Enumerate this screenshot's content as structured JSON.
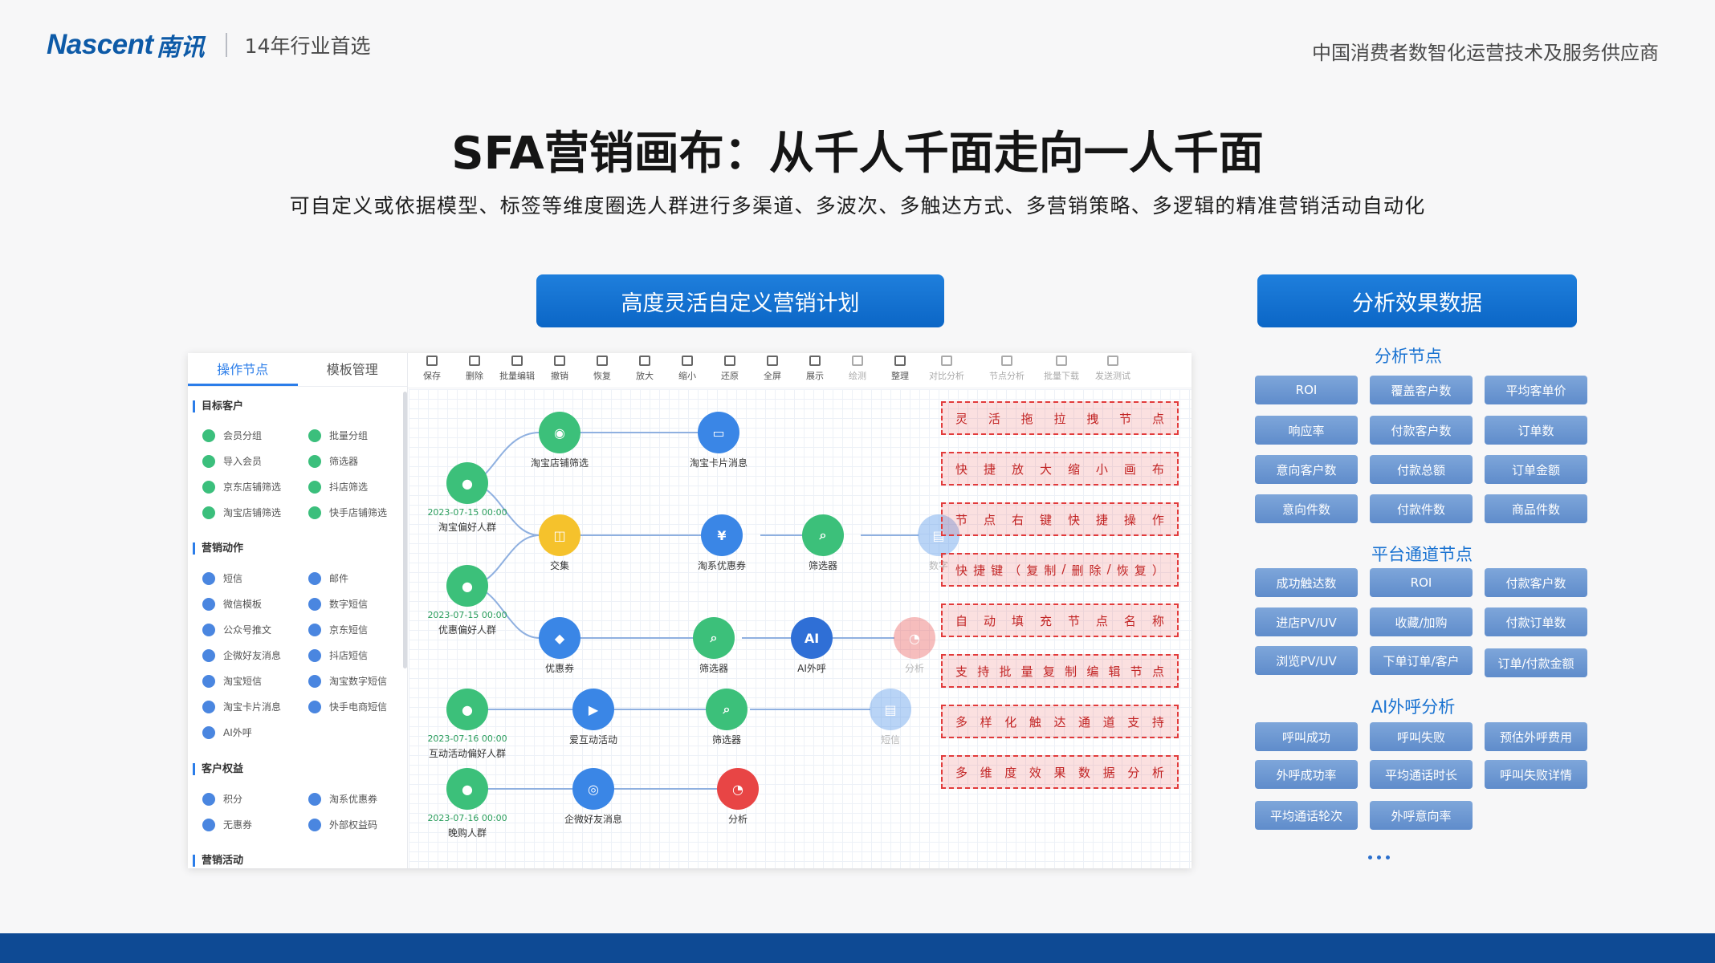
{
  "header": {
    "logo_text": "Nascent",
    "logo_cn": "南讯",
    "slogan": "14年行业首选",
    "tagline": "中国消费者数智化运营技术及服务供应商"
  },
  "title": "SFA营销画布：从千人千面走向一人千面",
  "subtitle": "可自定义或依据模型、标签等维度圈选人群进行多渠道、多波次、多触达方式、多营销策略、多逻辑的精准营销活动自动化",
  "left_button": "高度灵活自定义营销计划",
  "right_button": "分析效果数据",
  "canvas": {
    "tabs": [
      "操作节点",
      "模板管理"
    ],
    "sections": {
      "target": {
        "title": "目标客户",
        "items": [
          "会员分组",
          "批量分组",
          "导入会员",
          "筛选器",
          "京东店铺筛选",
          "抖店筛选",
          "淘宝店铺筛选",
          "快手店铺筛选"
        ]
      },
      "action": {
        "title": "营销动作",
        "items": [
          "短信",
          "邮件",
          "微信模板",
          "数字短信",
          "公众号推文",
          "京东短信",
          "企微好友消息",
          "抖店短信",
          "淘宝短信",
          "淘宝数字短信",
          "淘宝卡片消息",
          "快手电商短信",
          "AI外呼"
        ]
      },
      "rights": {
        "title": "客户权益",
        "items": [
          "积分",
          "淘系优惠券",
          "无惠券",
          "外部权益码"
        ]
      },
      "activity": {
        "title": "营销活动"
      }
    },
    "toolbar": [
      "保存",
      "删除",
      "批量编辑",
      "撤销",
      "恢复",
      "放大",
      "缩小",
      "还原",
      "全屏",
      "展示",
      "绘测",
      "整理",
      "对比分析",
      "节点分析",
      "批量下载",
      "发送测试"
    ],
    "nodes": {
      "n1": {
        "label": "淘宝偏好人群",
        "date": "2023-07-15 00:00"
      },
      "n2": {
        "label": "优惠偏好人群",
        "date": "2023-07-15 00:00"
      },
      "n3": {
        "label": "互动活动偏好人群",
        "date": "2023-07-16 00:00"
      },
      "n4": {
        "label": "晚购人群",
        "date": "2023-07-16 00:00"
      },
      "n5": {
        "label": "淘宝店铺筛选"
      },
      "n6": {
        "label": "淘宝卡片消息"
      },
      "n7": {
        "label": "交集"
      },
      "n8": {
        "label": "淘系优惠券"
      },
      "n9": {
        "label": "筛选器"
      },
      "n10": {
        "label": "数字"
      },
      "n11": {
        "label": "优惠券"
      },
      "n12": {
        "label": "筛选器"
      },
      "n13": {
        "label": "AI外呼"
      },
      "n14": {
        "label": "分析"
      },
      "n15": {
        "label": "爱互动活动"
      },
      "n16": {
        "label": "筛选器"
      },
      "n17": {
        "label": "短信"
      },
      "n18": {
        "label": "企微好友消息"
      },
      "n19": {
        "label": "分析"
      }
    },
    "features": [
      "灵活拖拉拽节点",
      "快捷放大缩小画布",
      "节点右键快捷操作",
      "快捷键（复制/删除/恢复）",
      "自动填充节点名称",
      "支持批量复制编辑节点",
      "多样化触达通道支持",
      "多维度效果数据分析"
    ]
  },
  "analysis": {
    "groups": [
      {
        "title": "分析节点",
        "metrics": [
          "ROI",
          "覆盖客户数",
          "平均客单价",
          "响应率",
          "付款客户数",
          "订单数",
          "意向客户数",
          "付款总额",
          "订单金额",
          "意向件数",
          "付款件数",
          "商品件数"
        ]
      },
      {
        "title": "平台通道节点",
        "metrics": [
          "成功触达数",
          "ROI",
          "付款客户数",
          "进店PV/UV",
          "收藏/加购",
          "付款订单数",
          "浏览PV/UV",
          "下单订单/客户",
          "订单/付款金额"
        ]
      },
      {
        "title": "AI外呼分析",
        "metrics": [
          "呼叫成功",
          "呼叫失败",
          "预估外呼费用",
          "外呼成功率",
          "平均通话时长",
          "呼叫失败详情",
          "平均通话轮次",
          "外呼意向率"
        ]
      }
    ]
  },
  "colors": {
    "brand": "#0d5aa7",
    "button": "#0b66c6",
    "metric": "#6e97d2",
    "feature_border": "#e23b3b",
    "footer": "#0e4a94"
  }
}
